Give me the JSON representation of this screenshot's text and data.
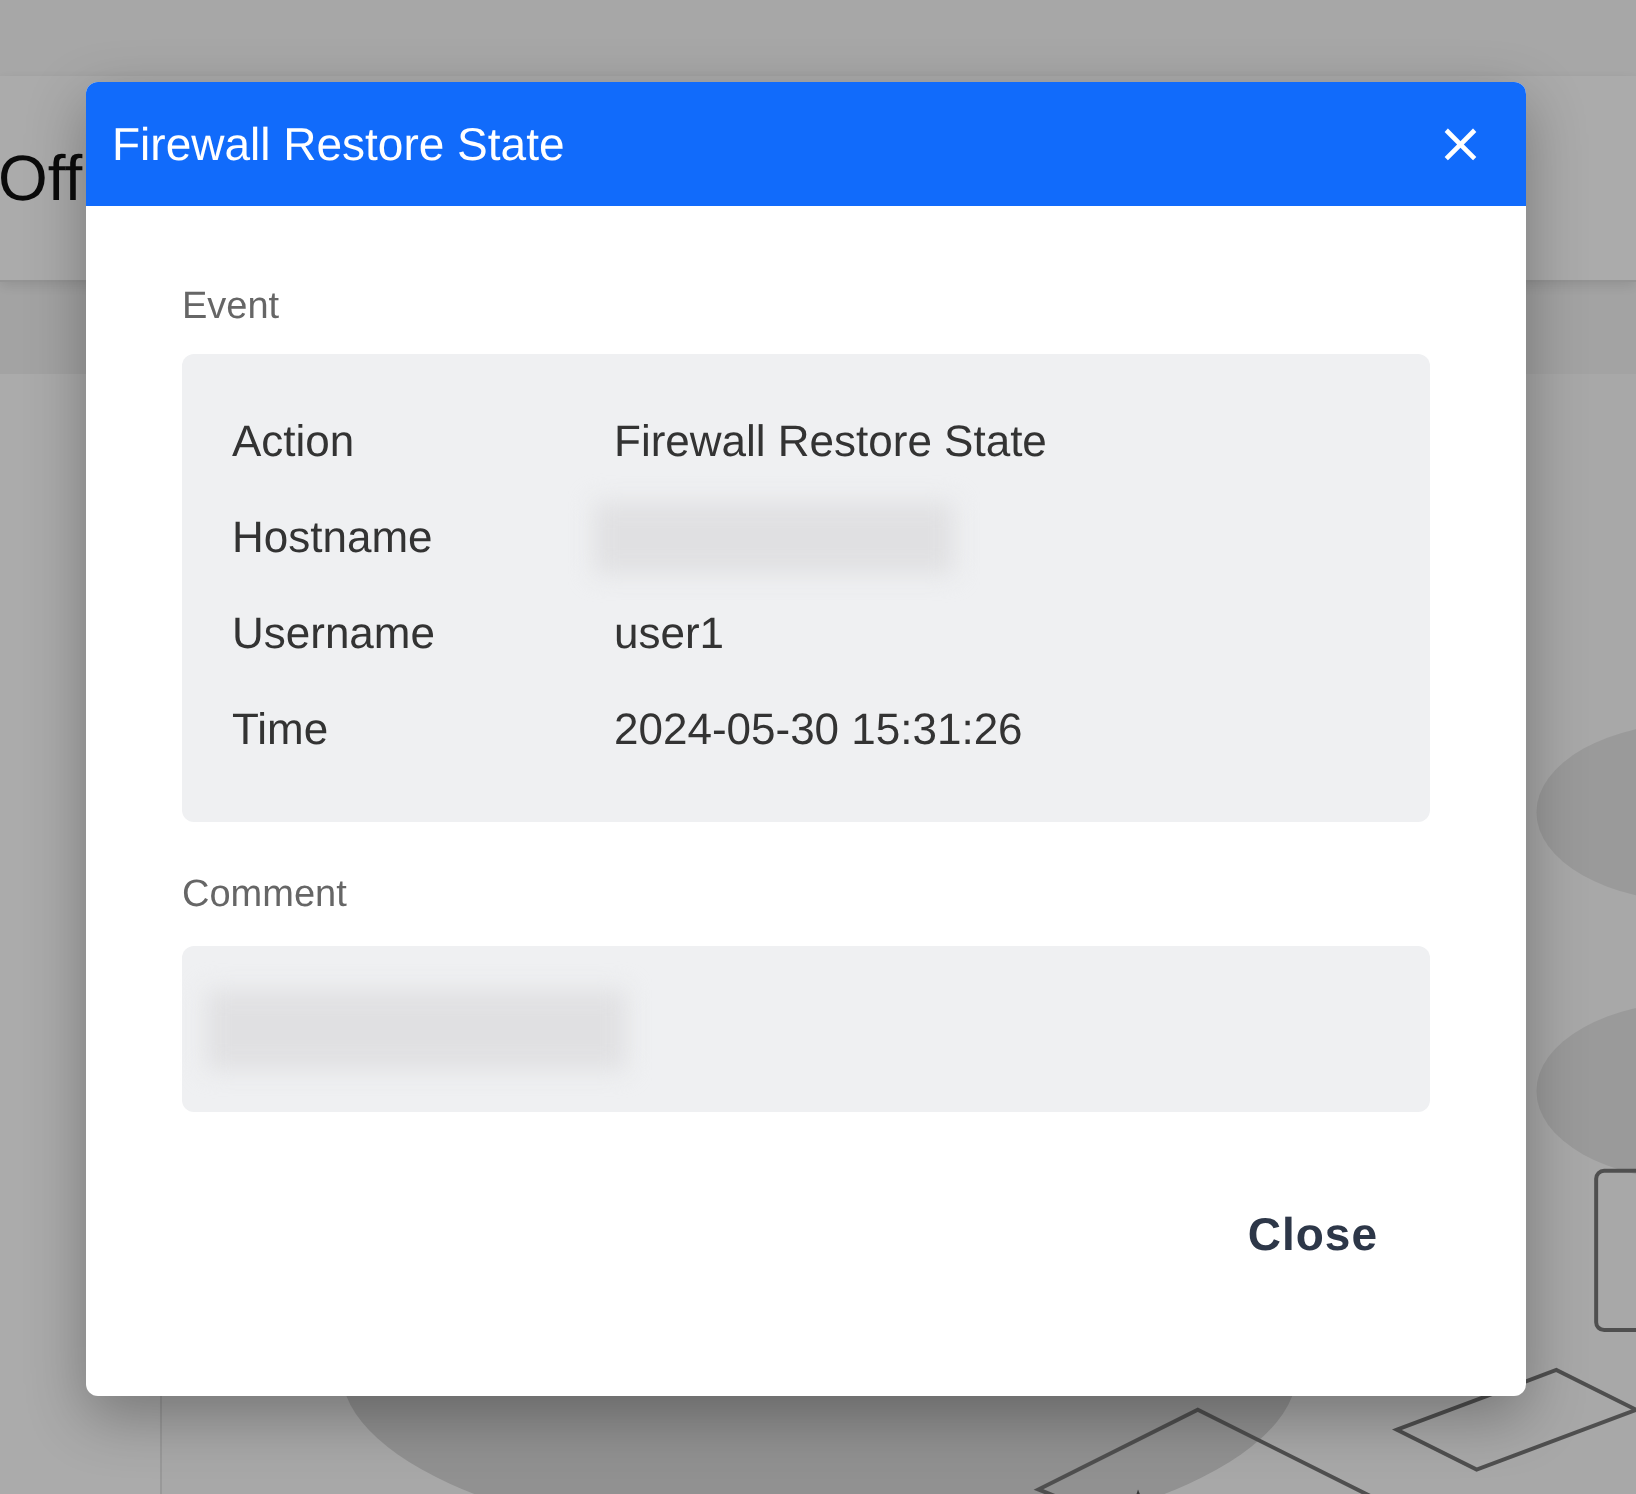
{
  "page": {
    "title": "Off"
  },
  "dialog": {
    "title": "Firewall Restore State",
    "close_icon": "×",
    "event": {
      "label": "Event",
      "fields": [
        {
          "label": "Action",
          "value": "Firewall Restore State",
          "redacted": false
        },
        {
          "label": "Hostname",
          "redacted": true
        },
        {
          "label": "Username",
          "value": "user1",
          "redacted": false
        },
        {
          "label": "Time",
          "value": "2024-05-30 15:31:26",
          "redacted": false
        }
      ]
    },
    "comment": {
      "label": "Comment",
      "redacted": true
    },
    "buttons": [
      "Close"
    ]
  }
}
